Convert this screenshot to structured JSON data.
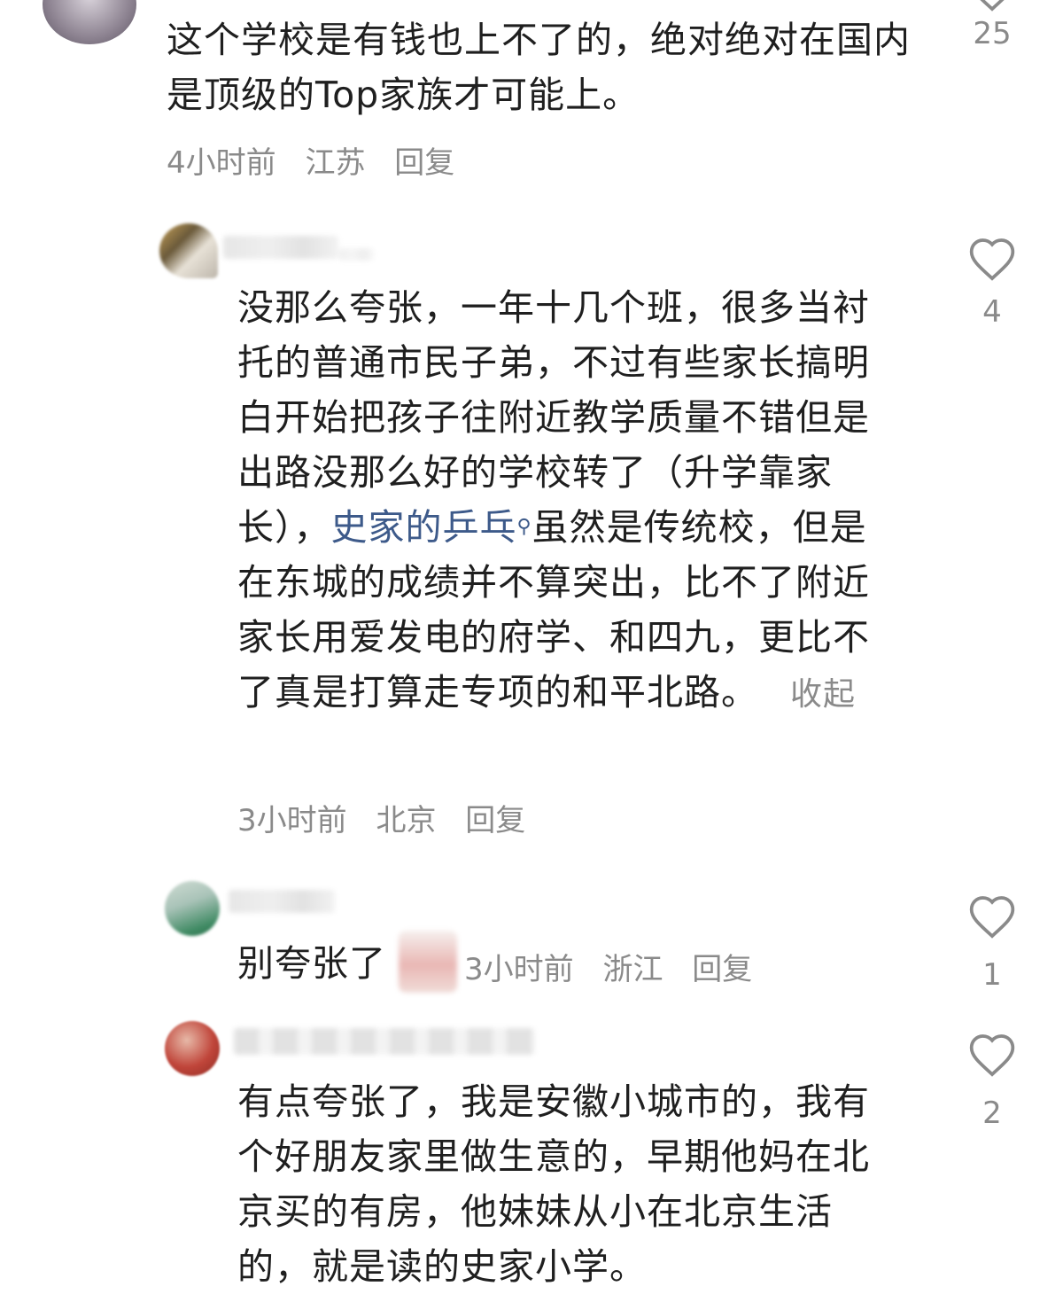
{
  "comments": [
    {
      "text": "这个学校是有钱也上不了的，绝对绝对在国内是顶级的Top家族才可能上。",
      "time": "4小时前",
      "location": "江苏",
      "reply": "回复",
      "likes": "25"
    },
    {
      "text_before": "没那么夸张，一年十几个班，很多当衬托的普通市民子弟，不过有些家长搞明白开始把孩子往附近教学质量不错但是出路没那么好的学校转了（升学靠家长），",
      "topic_link": "史家的乒乓",
      "text_after": "虽然是传统校，但是在东城的成绩并不算突出，比不了附近家长用爱发电的府学、和四九，更比不了真是打算走专项的和平北路。",
      "collapse": "收起",
      "time": "3小时前",
      "location": "北京",
      "reply": "回复",
      "likes": "4"
    },
    {
      "text": "别夸张了",
      "time": "3小时前",
      "location": "浙江",
      "reply": "回复",
      "likes": "1"
    },
    {
      "text": "有点夸张了，我是安徽小城市的，我有个好朋友家里做生意的，早期他妈在北京买的有房，他妹妹从小在北京生活的，就是读的史家小学。",
      "likes": "2"
    }
  ],
  "icons": {
    "like": "heart-outline-icon",
    "search": "search-icon"
  },
  "colors": {
    "text": "#1f1f1f",
    "meta": "#8a8a8a",
    "link": "#3d5a8a"
  }
}
